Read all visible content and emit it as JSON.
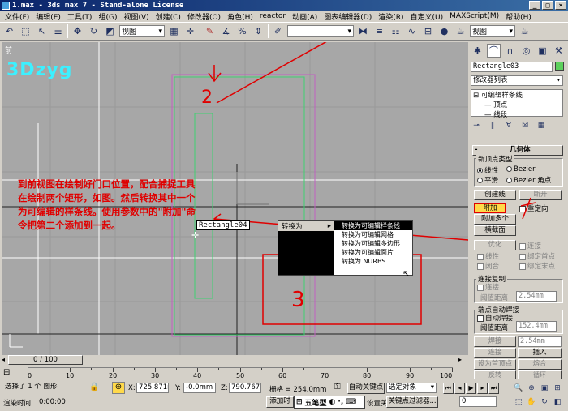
{
  "title": "1.max - 3ds max 7  - Stand-alone License",
  "menu": [
    "文件(F)",
    "编辑(E)",
    "工具(T)",
    "组(G)",
    "视图(V)",
    "创建(C)",
    "修改器(O)",
    "角色(H)",
    "reactor",
    "动画(A)",
    "图表编辑器(D)",
    "渲染(R)",
    "自定义(U)",
    "MAXScript(M)",
    "帮助(H)"
  ],
  "toolbar": {
    "view_select": "视图",
    "named_select": ""
  },
  "viewport": {
    "label": "前",
    "logo": "3Dzyg",
    "note": "到前视图在绘制好门口位置，配合捕捉工具在绘制两个矩形，如图。然后转换其中一个为可编辑的样条线。使用参数中的\"附加\"命令把第二个添加到一起。",
    "rect_tooltip": "Rectangle04",
    "annotations": [
      "2",
      "3",
      "1"
    ],
    "quad_menu": {
      "left_item": "转换为",
      "items": [
        "转换为可编辑样条线",
        "转换为可编辑网格",
        "转换为可编辑多边形",
        "转换为可编辑面片",
        "转换为 NURBS"
      ]
    }
  },
  "panel": {
    "object_name": "Rectangle03",
    "modifier_list": "修改器列表",
    "stack": [
      "可编辑样条线",
      "顶点",
      "线段"
    ],
    "rollout_title": "几何体",
    "new_vertex_type": "新顶点类型",
    "radio_linear": "线性",
    "radio_bezier": "Bezier",
    "radio_smooth": "平滑",
    "radio_bezier_corner": "Bezier 角点",
    "create_line": "创建线",
    "break": "断开",
    "attach": "附加",
    "reorient": "重定向",
    "attach_multiple": "附加多个",
    "cross_section": "横截面",
    "optimize": "优化",
    "connect": "连接",
    "linear": "线性",
    "bind_first": "绑定首点",
    "closed": "闭合",
    "bind_last": "绑定末点",
    "connect_copy": "连接复制",
    "connect2": "连接",
    "threshold_label": "阈值距离",
    "threshold_value": "2.54mm",
    "endpoint_weld": "端点自动焊接",
    "auto_weld": "自动焊接",
    "threshold2_label": "阈值距离",
    "threshold2_value": "152.4mm",
    "weld": "焊接",
    "weld_value": "2.54mm",
    "connect3": "连接",
    "insert": "插入",
    "set_first": "设为首顶点",
    "fuse": "熔合",
    "reverse": "反转",
    "cycle": "循环"
  },
  "timebar": {
    "frame": "0 / 100"
  },
  "ruler": [
    "0",
    "10",
    "20",
    "30",
    "40",
    "50",
    "60",
    "70",
    "80",
    "90",
    "100"
  ],
  "status": {
    "selection": "选择了 1 个 图形",
    "x_label": "X:",
    "x_value": "725.871mm",
    "y_label": "Y:",
    "y_value": "-0.0mm",
    "z_label": "Z:",
    "z_value": "790.767mm",
    "grid": "栅格 = 254.0mm",
    "autokey": "自动关键点",
    "selection_set": "选定对象",
    "set_key": "设置关键点",
    "key_filters": "关键点过滤器...",
    "render_time": "渲染时间",
    "time_value": "0:00:00",
    "add_time": "添加时",
    "ime": "五笔型",
    "frame_field": "0"
  },
  "colors": {
    "annotation": "#e00000",
    "logo": "#3cf0ff",
    "attach_highlight": "#ffd94a"
  }
}
